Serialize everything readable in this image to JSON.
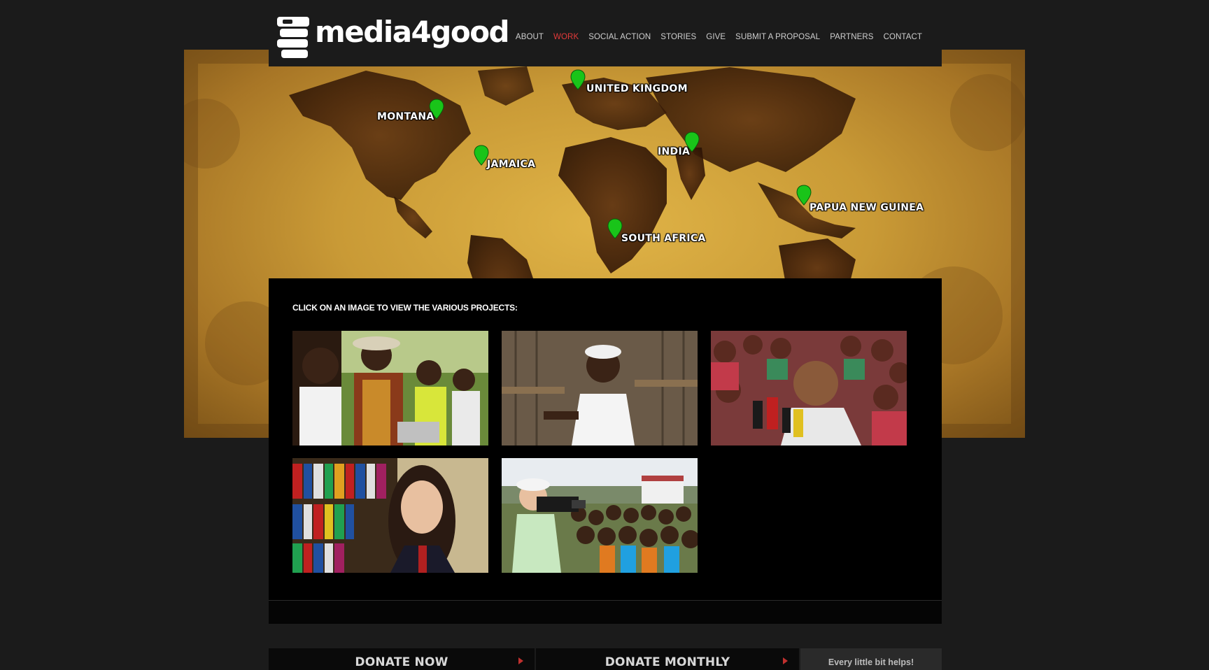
{
  "header": {
    "logo_text": "media4good",
    "nav": [
      {
        "label": "ABOUT",
        "active": false
      },
      {
        "label": "WORK",
        "active": true
      },
      {
        "label": "SOCIAL ACTION",
        "active": false
      },
      {
        "label": "STORIES",
        "active": false
      },
      {
        "label": "GIVE",
        "active": false
      },
      {
        "label": "SUBMIT A PROPOSAL",
        "active": false
      },
      {
        "label": "PARTNERS",
        "active": false
      },
      {
        "label": "CONTACT",
        "active": false
      }
    ]
  },
  "map": {
    "locations": [
      {
        "label": "UNITED KINGDOM"
      },
      {
        "label": "MONTANA"
      },
      {
        "label": "JAMAICA"
      },
      {
        "label": "INDIA"
      },
      {
        "label": "PAPUA NEW GUINEA"
      },
      {
        "label": "SOUTH AFRICA"
      }
    ],
    "pin_color": "#19c419"
  },
  "projects": {
    "title": "CLICK ON AN IMAGE TO VIEW THE VARIOUS PROJECTS:",
    "thumbnails": [
      {
        "name": "project-thumbnail-1"
      },
      {
        "name": "project-thumbnail-2"
      },
      {
        "name": "project-thumbnail-3"
      },
      {
        "name": "project-thumbnail-4"
      },
      {
        "name": "project-thumbnail-5"
      }
    ]
  },
  "donate": {
    "now_label": "DONATE NOW",
    "monthly_label": "DONATE MONTHLY",
    "tagline": "Every little bit helps!",
    "arrow_color": "#c0302e"
  },
  "colors": {
    "background": "#1b1b1b",
    "nav_text": "#cfcfcf",
    "nav_active": "#e23a3a",
    "panel": "#000000"
  }
}
